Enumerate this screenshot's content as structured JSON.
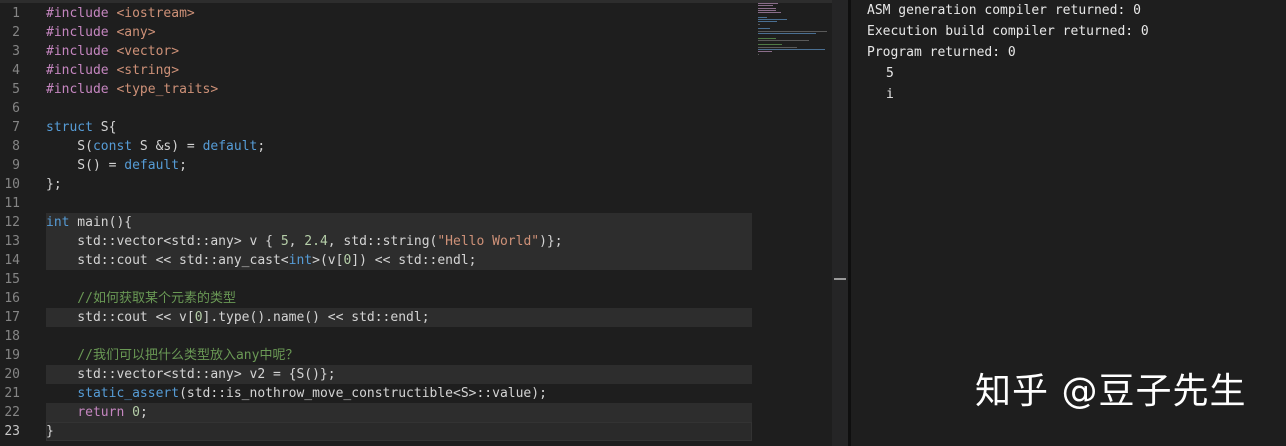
{
  "editor": {
    "line_numbers": [
      "1",
      "2",
      "3",
      "4",
      "5",
      "6",
      "7",
      "8",
      "9",
      "10",
      "11",
      "12",
      "13",
      "14",
      "15",
      "16",
      "17",
      "18",
      "19",
      "20",
      "21",
      "22",
      "23"
    ],
    "lines": [
      [
        {
          "t": "#include ",
          "c": "pp"
        },
        {
          "t": "<iostream>",
          "c": "inc"
        }
      ],
      [
        {
          "t": "#include ",
          "c": "pp"
        },
        {
          "t": "<any>",
          "c": "inc"
        }
      ],
      [
        {
          "t": "#include ",
          "c": "pp"
        },
        {
          "t": "<vector>",
          "c": "inc"
        }
      ],
      [
        {
          "t": "#include ",
          "c": "pp"
        },
        {
          "t": "<string>",
          "c": "inc"
        }
      ],
      [
        {
          "t": "#include ",
          "c": "pp"
        },
        {
          "t": "<type_traits>",
          "c": "inc"
        }
      ],
      [],
      [
        {
          "t": "struct",
          "c": "kw"
        },
        {
          "t": " S{",
          "c": ""
        }
      ],
      [
        {
          "t": "    S(",
          "c": ""
        },
        {
          "t": "const",
          "c": "kw"
        },
        {
          "t": " S &s) = ",
          "c": ""
        },
        {
          "t": "default",
          "c": "kw"
        },
        {
          "t": ";",
          "c": ""
        }
      ],
      [
        {
          "t": "    S() = ",
          "c": ""
        },
        {
          "t": "default",
          "c": "kw"
        },
        {
          "t": ";",
          "c": ""
        }
      ],
      [
        {
          "t": "};",
          "c": ""
        }
      ],
      [],
      [
        {
          "t": "int",
          "c": "kw"
        },
        {
          "t": " main(){",
          "c": ""
        }
      ],
      [
        {
          "t": "    std::vector<std::any> v { ",
          "c": ""
        },
        {
          "t": "5",
          "c": "num"
        },
        {
          "t": ", ",
          "c": ""
        },
        {
          "t": "2.4",
          "c": "num"
        },
        {
          "t": ", std::string(",
          "c": ""
        },
        {
          "t": "\"Hello World\"",
          "c": "str"
        },
        {
          "t": ")};",
          "c": ""
        }
      ],
      [
        {
          "t": "    std::cout << std::any_cast<",
          "c": ""
        },
        {
          "t": "int",
          "c": "kw"
        },
        {
          "t": ">(v[",
          "c": ""
        },
        {
          "t": "0",
          "c": "num"
        },
        {
          "t": "]) << std::endl;",
          "c": ""
        }
      ],
      [],
      [
        {
          "t": "    //如何获取某个元素的类型",
          "c": "cm"
        }
      ],
      [
        {
          "t": "    std::cout << v[",
          "c": ""
        },
        {
          "t": "0",
          "c": "num"
        },
        {
          "t": "].type().name() << std::endl;",
          "c": ""
        }
      ],
      [],
      [
        {
          "t": "    //我们可以把什么类型放入any中呢？",
          "c": "cm"
        }
      ],
      [
        {
          "t": "    std::vector<std::any> v2 = {S()};",
          "c": ""
        }
      ],
      [
        {
          "t": "    ",
          "c": ""
        },
        {
          "t": "static_assert",
          "c": "kw"
        },
        {
          "t": "(std::is_nothrow_move_constructible<S>::value);",
          "c": ""
        }
      ],
      [
        {
          "t": "    ",
          "c": ""
        },
        {
          "t": "return",
          "c": "pp"
        },
        {
          "t": " ",
          "c": ""
        },
        {
          "t": "0",
          "c": "num"
        },
        {
          "t": ";",
          "c": ""
        }
      ],
      [
        {
          "t": "}",
          "c": ""
        }
      ]
    ],
    "highlighted_lines": [
      12,
      13,
      14,
      17,
      20,
      22
    ],
    "current_line": 23
  },
  "output": {
    "status_lines": [
      "ASM generation compiler returned: 0",
      "Execution build compiler returned: 0",
      "Program returned: 0"
    ],
    "values": [
      "5",
      "i"
    ]
  },
  "watermark": {
    "text": "知乎 @豆子先生"
  }
}
